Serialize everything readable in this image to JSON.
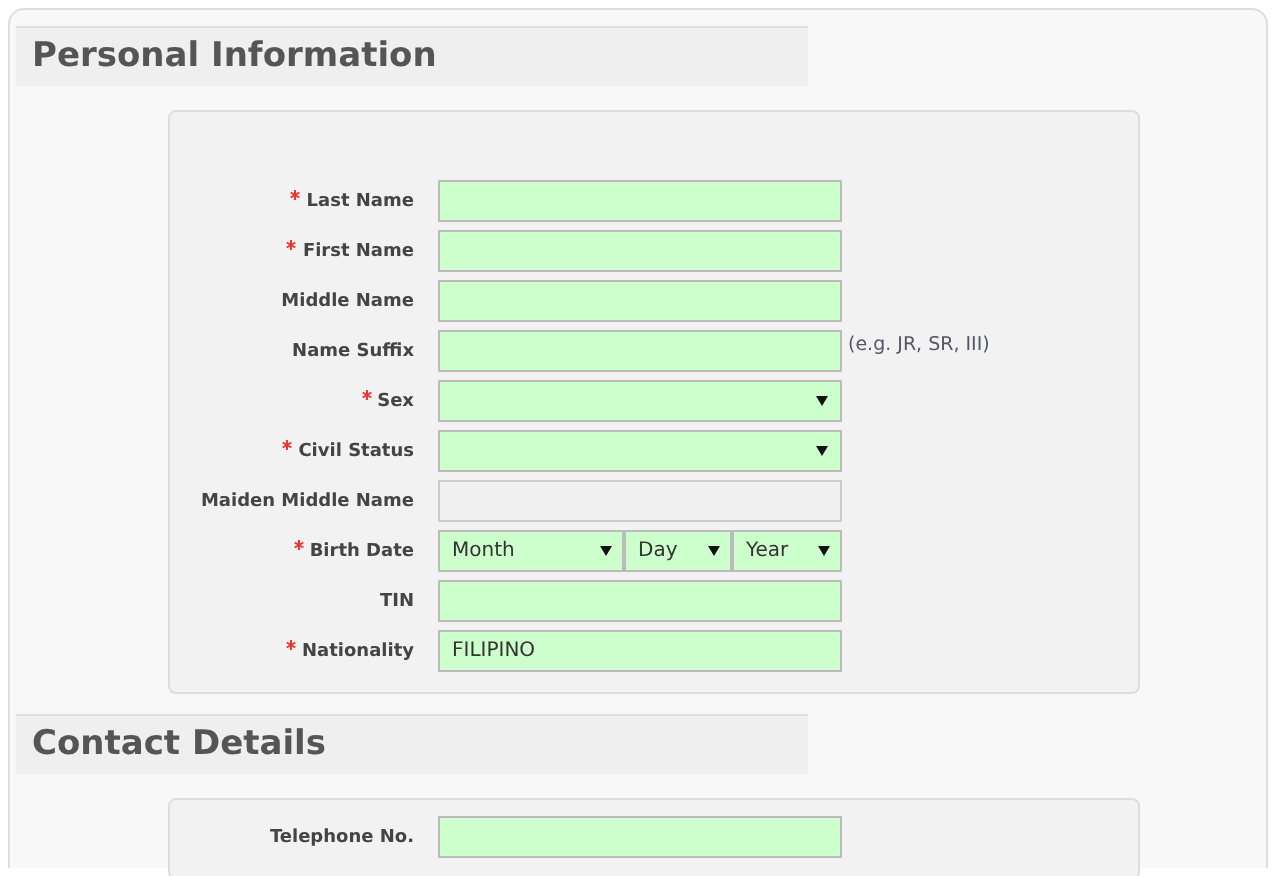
{
  "sections": [
    {
      "title": "Personal Information",
      "fields": [
        {
          "kind": "text",
          "label": "Last Name",
          "required": true,
          "disabled": false
        },
        {
          "kind": "text",
          "label": "First Name",
          "required": true,
          "disabled": false
        },
        {
          "kind": "text",
          "label": "Middle Name",
          "required": false,
          "disabled": false
        },
        {
          "kind": "text",
          "label": "Name Suffix",
          "required": false,
          "disabled": false,
          "hint": "(e.g. JR, SR, III)"
        },
        {
          "kind": "select",
          "label": "Sex",
          "required": true,
          "disabled": false
        },
        {
          "kind": "select",
          "label": "Civil Status",
          "required": true,
          "disabled": false
        },
        {
          "kind": "text",
          "label": "Maiden Middle Name",
          "required": false,
          "disabled": true
        },
        {
          "kind": "date",
          "label": "Birth Date",
          "required": true,
          "disabled": false,
          "parts": [
            "Month",
            "Day",
            "Year"
          ]
        },
        {
          "kind": "text",
          "label": "TIN",
          "required": false,
          "disabled": false
        },
        {
          "kind": "text",
          "label": "Nationality",
          "required": true,
          "disabled": false,
          "value": "FILIPINO"
        }
      ]
    },
    {
      "title": "Contact Details",
      "fields": [
        {
          "kind": "text",
          "label": "Telephone No.",
          "required": false,
          "disabled": false
        }
      ]
    }
  ]
}
